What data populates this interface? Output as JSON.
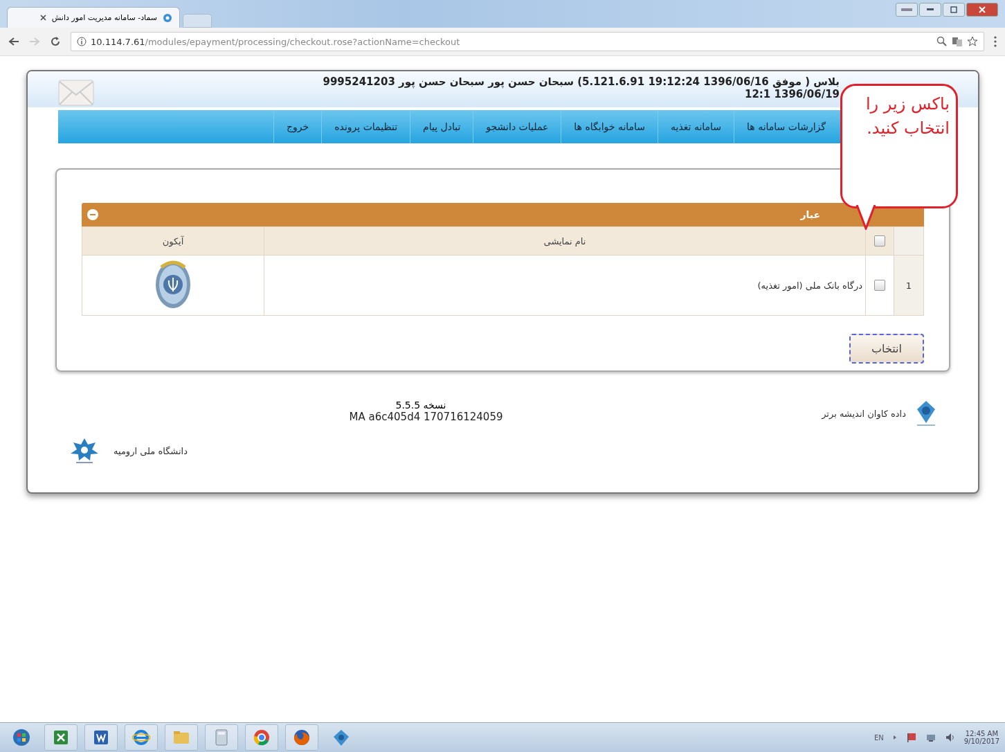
{
  "browser": {
    "tab_title": "سماد- سامانه مدیریت امور دانش",
    "address_host": "10.114.7.61",
    "address_path": "/modules/epayment/processing/checkout.rose?actionName=checkout"
  },
  "header": {
    "session_line": "بلاس ( موفق 1396/06/16 19:12:24 5.121.6.91) سبحان حسن پور سبحان حسن پور 9995241203",
    "date_line": "1396/06/19 12:1"
  },
  "nav": [
    {
      "label": "گزارشات سامانه ها"
    },
    {
      "label": "سامانه تغذیه"
    },
    {
      "label": "سامانه خوابگاه ها"
    },
    {
      "label": "عملیات دانشجو"
    },
    {
      "label": "تبادل پیام"
    },
    {
      "label": "تنظیمات پرونده"
    },
    {
      "label": "خروج"
    }
  ],
  "callout": {
    "text": "باکس زیر را انتخاب کنید."
  },
  "panel": {
    "title": "عبار",
    "select_all_checked": false,
    "columns": [
      "نام نمایشی",
      "آیکون"
    ],
    "rows": [
      {
        "number": "1",
        "checked": false,
        "name": "درگاه بانک ملی (امور تغذیه)"
      }
    ],
    "button": "انتخاب"
  },
  "footer": {
    "version": "نسخه 5.5.5",
    "build": "MA a6c405d4 170716124059",
    "vendor": "داده کاوان اندیشه برتر",
    "university": "دانشگاه ملی ارومیه"
  },
  "taskbar": {
    "language": "EN",
    "time": "12:45 AM",
    "date": "9/10/2017"
  }
}
